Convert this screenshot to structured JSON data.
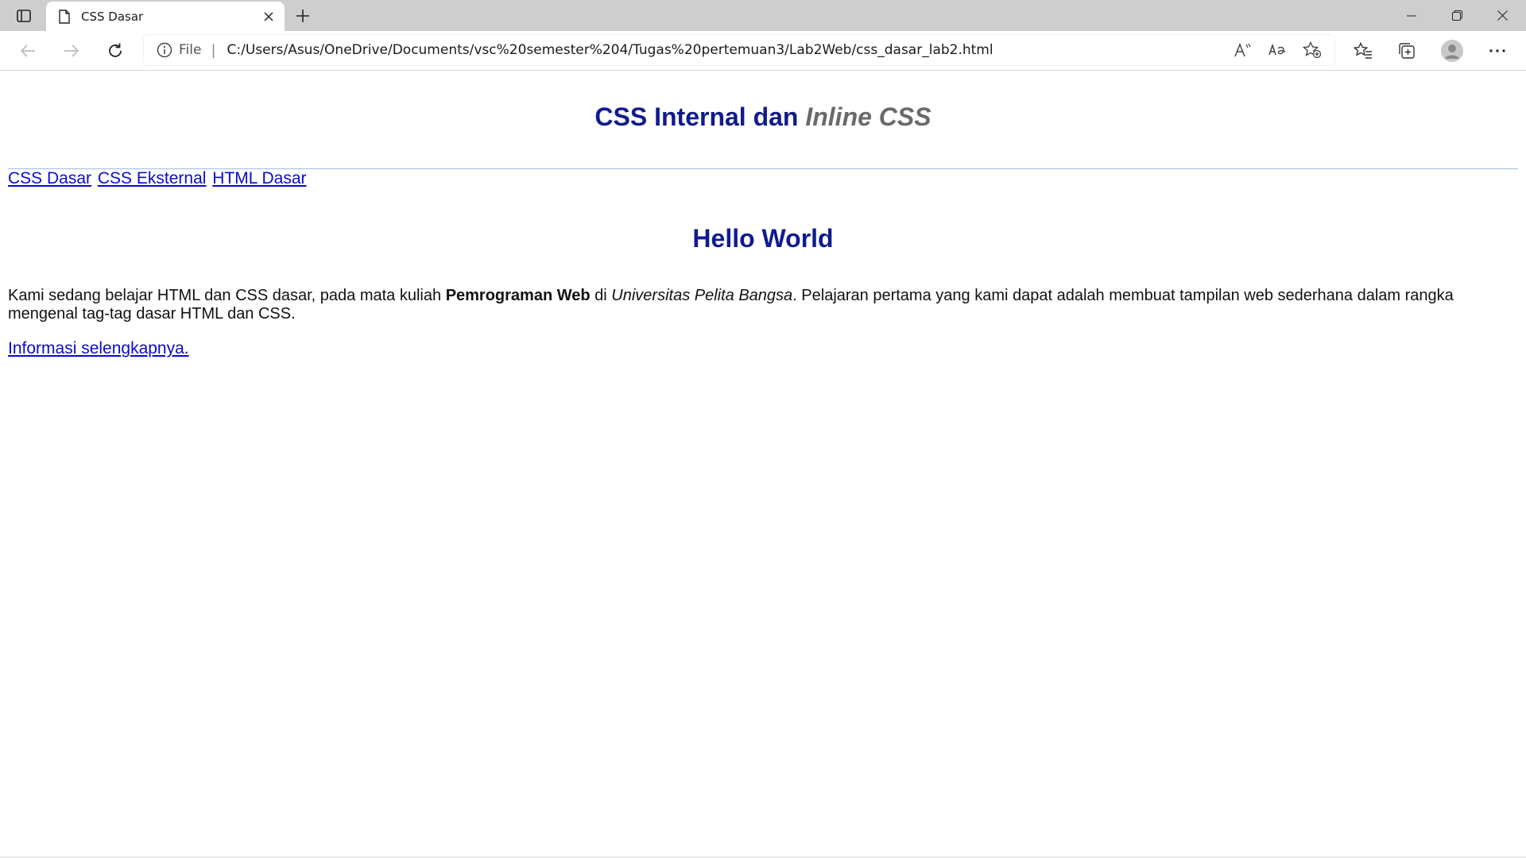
{
  "browser": {
    "tab": {
      "title": "CSS Dasar"
    },
    "address": {
      "scheme_label": "File",
      "separator": "|",
      "url": "C:/Users/Asus/OneDrive/Documents/vsc%20semester%204/Tugas%20pertemuan3/Lab2Web/css_dasar_lab2.html"
    },
    "icons": {
      "tab_actions": "tab-actions-icon",
      "page": "document-icon",
      "close": "close-icon",
      "new_tab": "plus-icon",
      "back": "arrow-left-icon",
      "forward": "arrow-right-icon",
      "refresh": "refresh-icon",
      "info": "info-icon",
      "read_aloud": "read-aloud-icon",
      "translate": "translate-icon",
      "add_favorite": "star-add-icon",
      "favorites": "favorites-icon",
      "collections": "collections-icon",
      "profile": "avatar",
      "more": "more-icon"
    }
  },
  "page": {
    "header": {
      "part1": "CSS Internal dan ",
      "part2": "Inline CSS"
    },
    "nav": [
      "CSS Dasar",
      "CSS Eksternal",
      "HTML Dasar"
    ],
    "heading": "Hello World",
    "paragraph": {
      "text1": "Kami sedang belajar HTML dan CSS dasar, pada mata kuliah ",
      "bold": "Pemrograman Web",
      "text2": " di ",
      "italic": "Universitas Pelita Bangsa",
      "text3": ". Pelajaran pertama yang kami dapat adalah membuat tampilan web sederhana dalam rangka mengenal tag-tag dasar HTML dan CSS."
    },
    "more_link": "Informasi selengkapnya."
  },
  "colors": {
    "heading": "#101b8e",
    "inline_css": "#6a6a6a",
    "link": "#0a0ad0",
    "divider": "#9dbbe0",
    "tabbar": "#cecece"
  }
}
